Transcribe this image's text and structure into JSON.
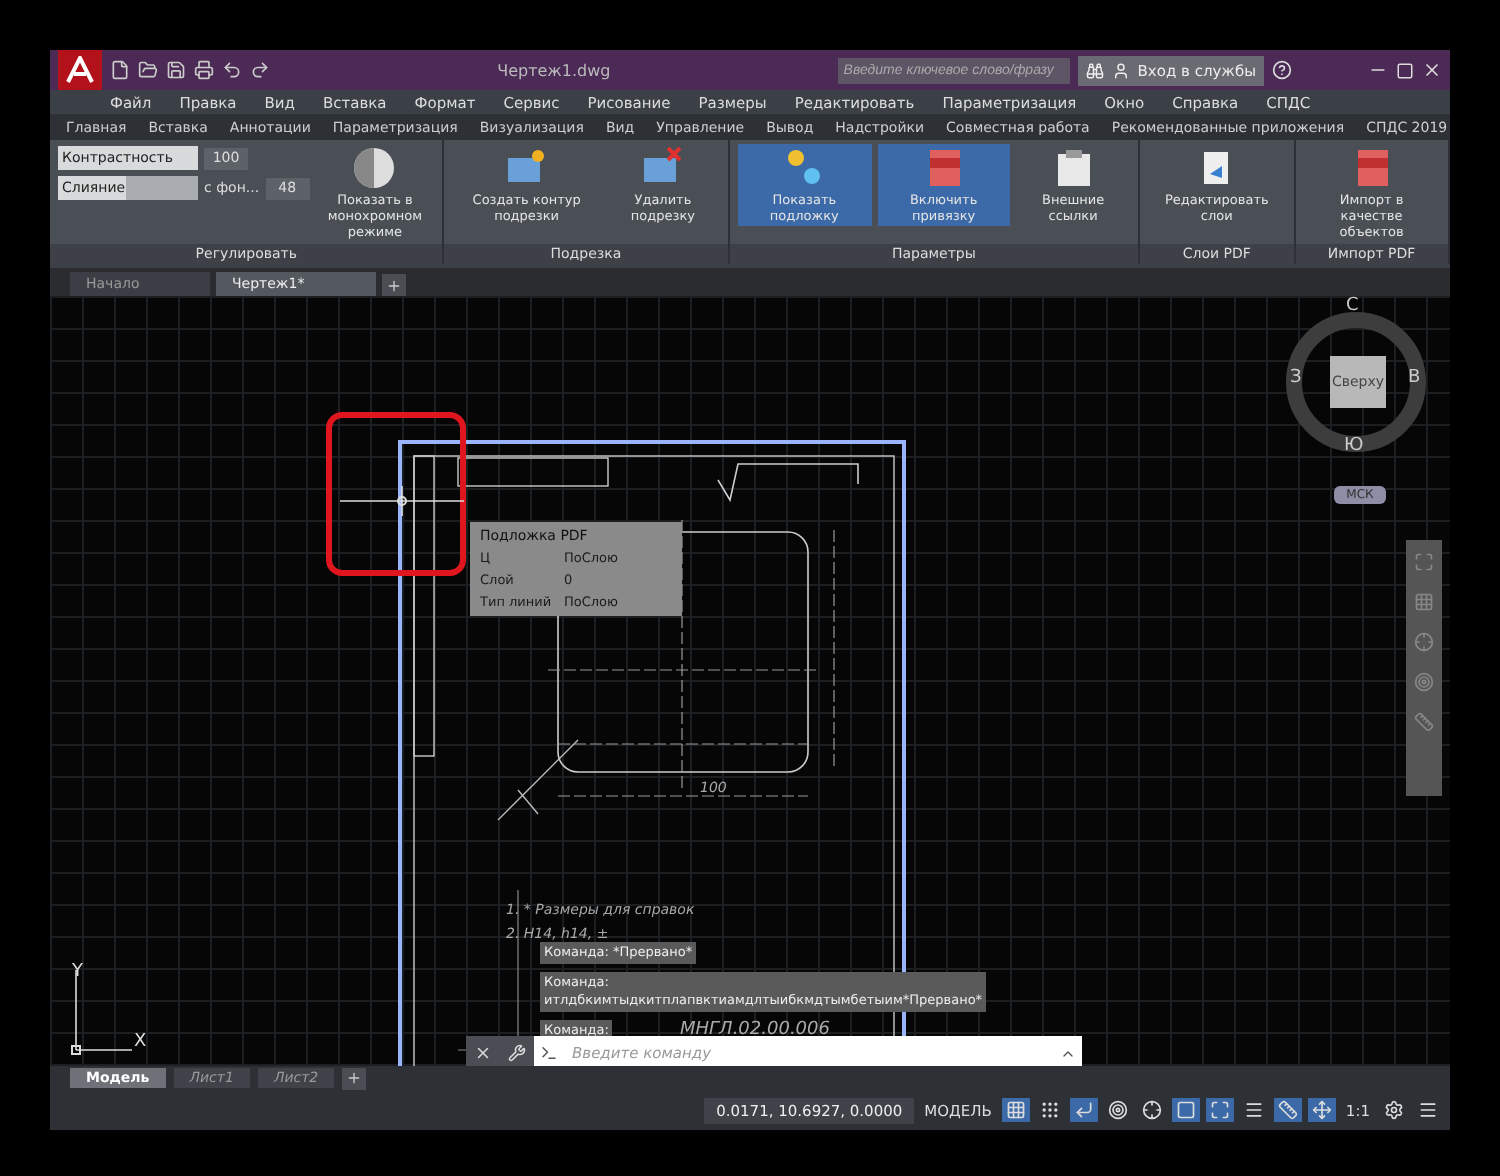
{
  "window": {
    "title": "Чертеж1.dwg",
    "search": {
      "placeholder": "Введите ключевое слово/фразу"
    },
    "sign_in": "Вход в службы"
  },
  "menu": [
    "Файл",
    "Правка",
    "Вид",
    "Вставка",
    "Формат",
    "Сервис",
    "Рисование",
    "Размеры",
    "Редактировать",
    "Параметризация",
    "Окно",
    "Справка",
    "СПДС"
  ],
  "ribbon_tabs": [
    {
      "label": "Главная",
      "selected": false
    },
    {
      "label": "Вставка",
      "selected": false
    },
    {
      "label": "Аннотации",
      "selected": false
    },
    {
      "label": "Параметризация",
      "selected": false
    },
    {
      "label": "Визуализация",
      "selected": false
    },
    {
      "label": "Вид",
      "selected": false
    },
    {
      "label": "Управление",
      "selected": false
    },
    {
      "label": "Вывод",
      "selected": false
    },
    {
      "label": "Надстройки",
      "selected": false
    },
    {
      "label": "Совместная работа",
      "selected": false
    },
    {
      "label": "Рекомендованные приложения",
      "selected": false
    },
    {
      "label": "СПДС 2019",
      "selected": false
    }
  ],
  "ribbon_panels": [
    {
      "title": "Регулировать",
      "sliders": [
        {
          "label": "Контрастность",
          "value": "100",
          "level": 1
        },
        {
          "label": "Слияние",
          "suffix": "с фон...",
          "value": "48",
          "level": 0.48
        }
      ],
      "buttons": [
        {
          "label": "Показать в монохромном режиме",
          "selected": false
        }
      ]
    },
    {
      "title": "Подрезка",
      "buttons": [
        {
          "label": "Создать контур подрезки",
          "selected": false
        },
        {
          "label": "Удалить подрезку",
          "selected": false
        }
      ]
    },
    {
      "title": "Параметры",
      "buttons": [
        {
          "label": "Показать подложку",
          "selected": true
        },
        {
          "label": "Включить привязку",
          "selected": true
        },
        {
          "label": "Внешние ссылки",
          "selected": false
        }
      ]
    },
    {
      "title": "Слои PDF",
      "buttons": [
        {
          "label": "Редактировать слои",
          "selected": false
        }
      ]
    },
    {
      "title": "Импорт PDF",
      "buttons": [
        {
          "label": "Импорт в качестве объектов",
          "selected": false
        }
      ]
    }
  ],
  "doc_tabs": [
    {
      "label": "Начало",
      "selected": false
    },
    {
      "label": "Чертеж1*",
      "selected": true
    }
  ],
  "drawing": {
    "dimension": "100",
    "note_1": "1. * Размеры для справок",
    "note_2": "2. H14, h14, ±",
    "stamp": "МНГЛ.02.00.006"
  },
  "tooltip": {
    "title": "Подложка PDF",
    "rows": [
      {
        "label": "Ц",
        "value": "ПоСлою"
      },
      {
        "label": "Слой",
        "value": "0"
      },
      {
        "label": "Тип линий",
        "value": "ПоСлою"
      }
    ]
  },
  "viewcube": {
    "north": "С",
    "west": "З",
    "east": "В",
    "south": "Ю",
    "face": "Сверху",
    "ucs": "МСК"
  },
  "ucs_icon": {
    "x": "X",
    "y": "Y"
  },
  "command_history": [
    "Команда: *Прервано*",
    "Команда:\nитлдбкимтыдкитплапвктиамдлтыибкмдтымбетыим*Прервано*",
    "Команда:"
  ],
  "command_line": {
    "placeholder": "Введите команду"
  },
  "layout_tabs": [
    {
      "label": "Модель",
      "selected": true
    },
    {
      "label": "Лист1",
      "selected": false
    },
    {
      "label": "Лист2",
      "selected": false
    }
  ],
  "status_bar": {
    "coords": "0.0171, 10.6927, 0.0000",
    "space": "МОДЕЛЬ",
    "scale": "1:1",
    "toggles": [
      {
        "kind": "grid",
        "on": true
      },
      {
        "kind": "snap",
        "on": false
      },
      {
        "kind": "ortho",
        "on": true
      },
      {
        "kind": "polar",
        "on": false
      },
      {
        "kind": "iso",
        "on": false
      },
      {
        "kind": "osnap",
        "on": true
      },
      {
        "kind": "otrack",
        "on": true
      },
      {
        "kind": "lineweight",
        "on": false
      },
      {
        "kind": "annovis",
        "on": true
      },
      {
        "kind": "autoscale",
        "on": true
      }
    ]
  }
}
